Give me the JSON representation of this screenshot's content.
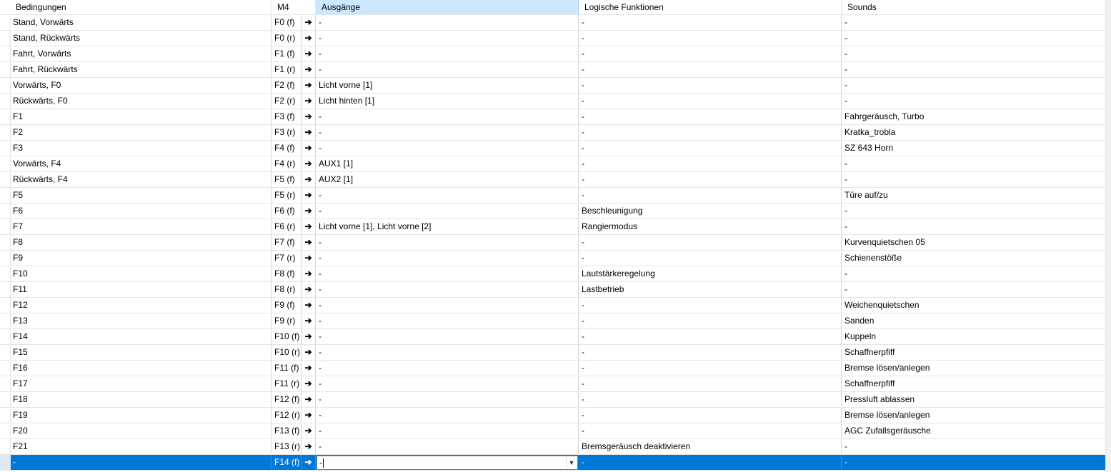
{
  "columns": [
    "Bedingungen",
    "M4",
    "",
    "Ausgänge",
    "Logische Funktionen",
    "Sounds"
  ],
  "arrow_glyph": "➔",
  "rows": [
    {
      "cond": "Stand, Vorwärts",
      "m4": "F0 (f)",
      "out": "-",
      "logic": "-",
      "sound": "-"
    },
    {
      "cond": "Stand, Rückwärts",
      "m4": "F0 (r)",
      "out": "-",
      "logic": "-",
      "sound": "-"
    },
    {
      "cond": "Fahrt, Vorwärts",
      "m4": "F1 (f)",
      "out": "-",
      "logic": "-",
      "sound": "-"
    },
    {
      "cond": "Fahrt, Rückwärts",
      "m4": "F1 (r)",
      "out": "-",
      "logic": "-",
      "sound": "-"
    },
    {
      "cond": "Vorwärts, F0",
      "m4": "F2 (f)",
      "out": "Licht vorne [1]",
      "logic": "-",
      "sound": "-"
    },
    {
      "cond": "Rückwärts, F0",
      "m4": "F2 (r)",
      "out": "Licht hinten [1]",
      "logic": "-",
      "sound": "-"
    },
    {
      "cond": "F1",
      "m4": "F3 (f)",
      "out": "-",
      "logic": "-",
      "sound": "Fahrgeräusch, Turbo"
    },
    {
      "cond": "F2",
      "m4": "F3 (r)",
      "out": "-",
      "logic": "-",
      "sound": "Kratka_trobla"
    },
    {
      "cond": "F3",
      "m4": "F4 (f)",
      "out": "-",
      "logic": "-",
      "sound": "SZ 643 Horn"
    },
    {
      "cond": "Vorwärts, F4",
      "m4": "F4 (r)",
      "out": "AUX1 [1]",
      "logic": "-",
      "sound": "-"
    },
    {
      "cond": "Rückwärts, F4",
      "m4": "F5 (f)",
      "out": "AUX2 [1]",
      "logic": "-",
      "sound": "-"
    },
    {
      "cond": "F5",
      "m4": "F5 (r)",
      "out": "-",
      "logic": "-",
      "sound": "Türe auf/zu"
    },
    {
      "cond": "F6",
      "m4": "F6 (f)",
      "out": "-",
      "logic": "Beschleunigung",
      "sound": "-"
    },
    {
      "cond": "F7",
      "m4": "F6 (r)",
      "out": "Licht vorne [1], Licht vorne [2]",
      "logic": "Rangiermodus",
      "sound": "-"
    },
    {
      "cond": "F8",
      "m4": "F7 (f)",
      "out": "-",
      "logic": "-",
      "sound": "Kurvenquietschen 05"
    },
    {
      "cond": "F9",
      "m4": "F7 (r)",
      "out": "-",
      "logic": "-",
      "sound": "Schienenstöße"
    },
    {
      "cond": "F10",
      "m4": "F8 (f)",
      "out": "-",
      "logic": "Lautstärkeregelung",
      "sound": "-"
    },
    {
      "cond": "F11",
      "m4": "F8 (r)",
      "out": "-",
      "logic": "Lastbetrieb",
      "sound": "-"
    },
    {
      "cond": "F12",
      "m4": "F9 (f)",
      "out": "-",
      "logic": "-",
      "sound": "Weichenquietschen"
    },
    {
      "cond": "F13",
      "m4": "F9 (r)",
      "out": "-",
      "logic": "-",
      "sound": "Sanden"
    },
    {
      "cond": "F14",
      "m4": "F10 (f)",
      "out": "-",
      "logic": "-",
      "sound": "Kuppeln"
    },
    {
      "cond": "F15",
      "m4": "F10 (r)",
      "out": "-",
      "logic": "-",
      "sound": "Schaffnerpfiff"
    },
    {
      "cond": "F16",
      "m4": "F11 (f)",
      "out": "-",
      "logic": "-",
      "sound": "Bremse lösen/anlegen"
    },
    {
      "cond": "F17",
      "m4": "F11 (r)",
      "out": "-",
      "logic": "-",
      "sound": "Schaffnerpfiff"
    },
    {
      "cond": "F18",
      "m4": "F12 (f)",
      "out": "-",
      "logic": "-",
      "sound": "Pressluft ablassen"
    },
    {
      "cond": "F19",
      "m4": "F12 (r)",
      "out": "-",
      "logic": "-",
      "sound": "Bremse lösen/anlegen"
    },
    {
      "cond": "F20",
      "m4": "F13 (f)",
      "out": "-",
      "logic": "-",
      "sound": "AGC Zufallsgeräusche"
    },
    {
      "cond": "F21",
      "m4": "F13 (r)",
      "out": "-",
      "logic": "Bremsgeräusch deaktivieren",
      "sound": "-"
    }
  ],
  "active_row": {
    "cond": "-",
    "m4": "F14 (f)",
    "out": "-",
    "logic": "-",
    "sound": "-"
  },
  "colors": {
    "selection": "#0078d7",
    "header_selected": "#cce8ff"
  }
}
